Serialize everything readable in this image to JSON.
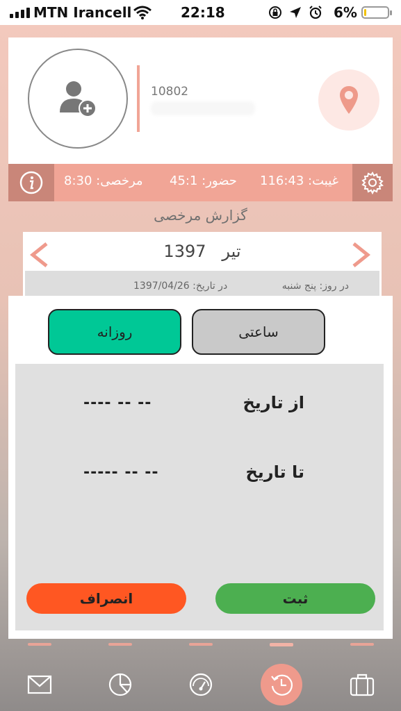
{
  "status_bar": {
    "carrier": "MTN Irancell",
    "time": "22:18",
    "battery": "6%",
    "battery_level": 0.06
  },
  "profile": {
    "user_id": "10802"
  },
  "stats": {
    "absence": "غیبت: 116:43",
    "presence": "حضور: 45:1",
    "leave": "مرخصی: 8:30"
  },
  "section_title": "گزارش مرخصی",
  "month": {
    "year": "1397",
    "name": "تیر",
    "day_label": "در روز: پنج شنبه",
    "date_label": "در تاریخ: 1397/04/26"
  },
  "dialog": {
    "tab_daily": "روزانه",
    "tab_hourly": "ساعتی",
    "from_label": "از تاریخ",
    "from_value": "---- -- --",
    "to_label": "تا تاریخ",
    "to_value": "----- -- --",
    "cancel_label": "انصراف",
    "submit_label": "ثبت"
  },
  "colors": {
    "accent": "#f1a596",
    "daily_tab": "#00c896",
    "cancel": "#ff5722",
    "submit": "#4caf50"
  },
  "bottom_nav": {
    "items": [
      "mail-icon",
      "pie-chart-icon",
      "speedometer-icon",
      "history-icon",
      "briefcase-icon"
    ],
    "active_index": 3
  }
}
